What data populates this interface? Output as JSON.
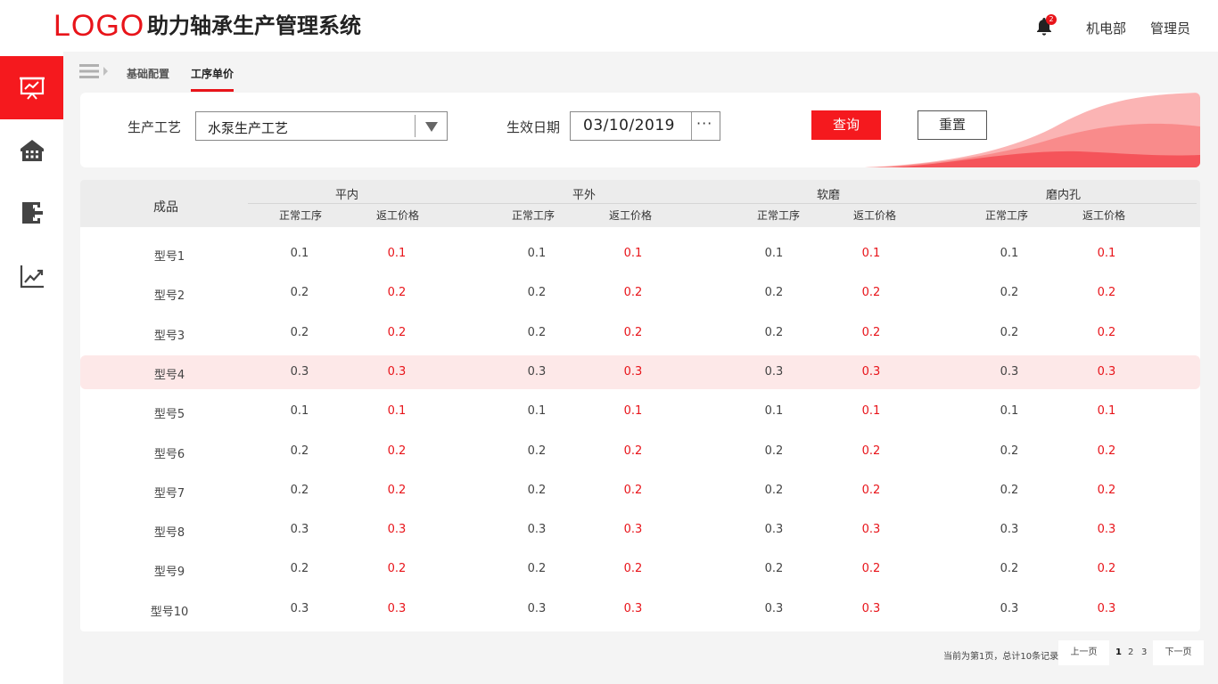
{
  "header": {
    "logo": "LOGO",
    "title": "助力轴承生产管理系统",
    "notification_count": "2",
    "department": "机电部",
    "user": "管理员"
  },
  "sidebar": {
    "items": [
      {
        "icon": "presentation-chart-icon",
        "active": true
      },
      {
        "icon": "building-icon",
        "active": false
      },
      {
        "icon": "exit-door-icon",
        "active": false
      },
      {
        "icon": "line-chart-icon",
        "active": false
      }
    ]
  },
  "breadcrumb": {
    "parent": "基础配置",
    "current": "工序单价"
  },
  "filter": {
    "process_label": "生产工艺",
    "process_value": "水泵生产工艺",
    "date_label": "生效日期",
    "date_value": "03/10/2019",
    "date_more": "···",
    "query_label": "查询",
    "reset_label": "重置"
  },
  "table": {
    "product_header": "成品",
    "groups": [
      "平内",
      "平外",
      "软磨",
      "磨内孔"
    ],
    "sub_headers": [
      "正常工序",
      "返工价格"
    ],
    "rows": [
      {
        "name": "型号1",
        "values": [
          "0.1",
          "0.1",
          "0.1",
          "0.1",
          "0.1",
          "0.1",
          "0.1",
          "0.1"
        ]
      },
      {
        "name": "型号2",
        "values": [
          "0.2",
          "0.2",
          "0.2",
          "0.2",
          "0.2",
          "0.2",
          "0.2",
          "0.2"
        ]
      },
      {
        "name": "型号3",
        "values": [
          "0.2",
          "0.2",
          "0.2",
          "0.2",
          "0.2",
          "0.2",
          "0.2",
          "0.2"
        ]
      },
      {
        "name": "型号4",
        "values": [
          "0.3",
          "0.3",
          "0.3",
          "0.3",
          "0.3",
          "0.3",
          "0.3",
          "0.3"
        ],
        "highlighted": true
      },
      {
        "name": "型号5",
        "values": [
          "0.1",
          "0.1",
          "0.1",
          "0.1",
          "0.1",
          "0.1",
          "0.1",
          "0.1"
        ]
      },
      {
        "name": "型号6",
        "values": [
          "0.2",
          "0.2",
          "0.2",
          "0.2",
          "0.2",
          "0.2",
          "0.2",
          "0.2"
        ]
      },
      {
        "name": "型号7",
        "values": [
          "0.2",
          "0.2",
          "0.2",
          "0.2",
          "0.2",
          "0.2",
          "0.2",
          "0.2"
        ]
      },
      {
        "name": "型号8",
        "values": [
          "0.3",
          "0.3",
          "0.3",
          "0.3",
          "0.3",
          "0.3",
          "0.3",
          "0.3"
        ]
      },
      {
        "name": "型号9",
        "values": [
          "0.2",
          "0.2",
          "0.2",
          "0.2",
          "0.2",
          "0.2",
          "0.2",
          "0.2"
        ]
      },
      {
        "name": "型号10",
        "values": [
          "0.3",
          "0.3",
          "0.3",
          "0.3",
          "0.3",
          "0.3",
          "0.3",
          "0.3"
        ]
      }
    ]
  },
  "pagination": {
    "info": "当前为第1页，总计10条记录",
    "prev_label": "上一页",
    "next_label": "下一页",
    "pages": [
      "1",
      "2",
      "3"
    ],
    "current_page": "1"
  },
  "colors": {
    "accent": "#f5191e",
    "highlight_row": "#fde8e8",
    "red_text": "#e8141a"
  }
}
